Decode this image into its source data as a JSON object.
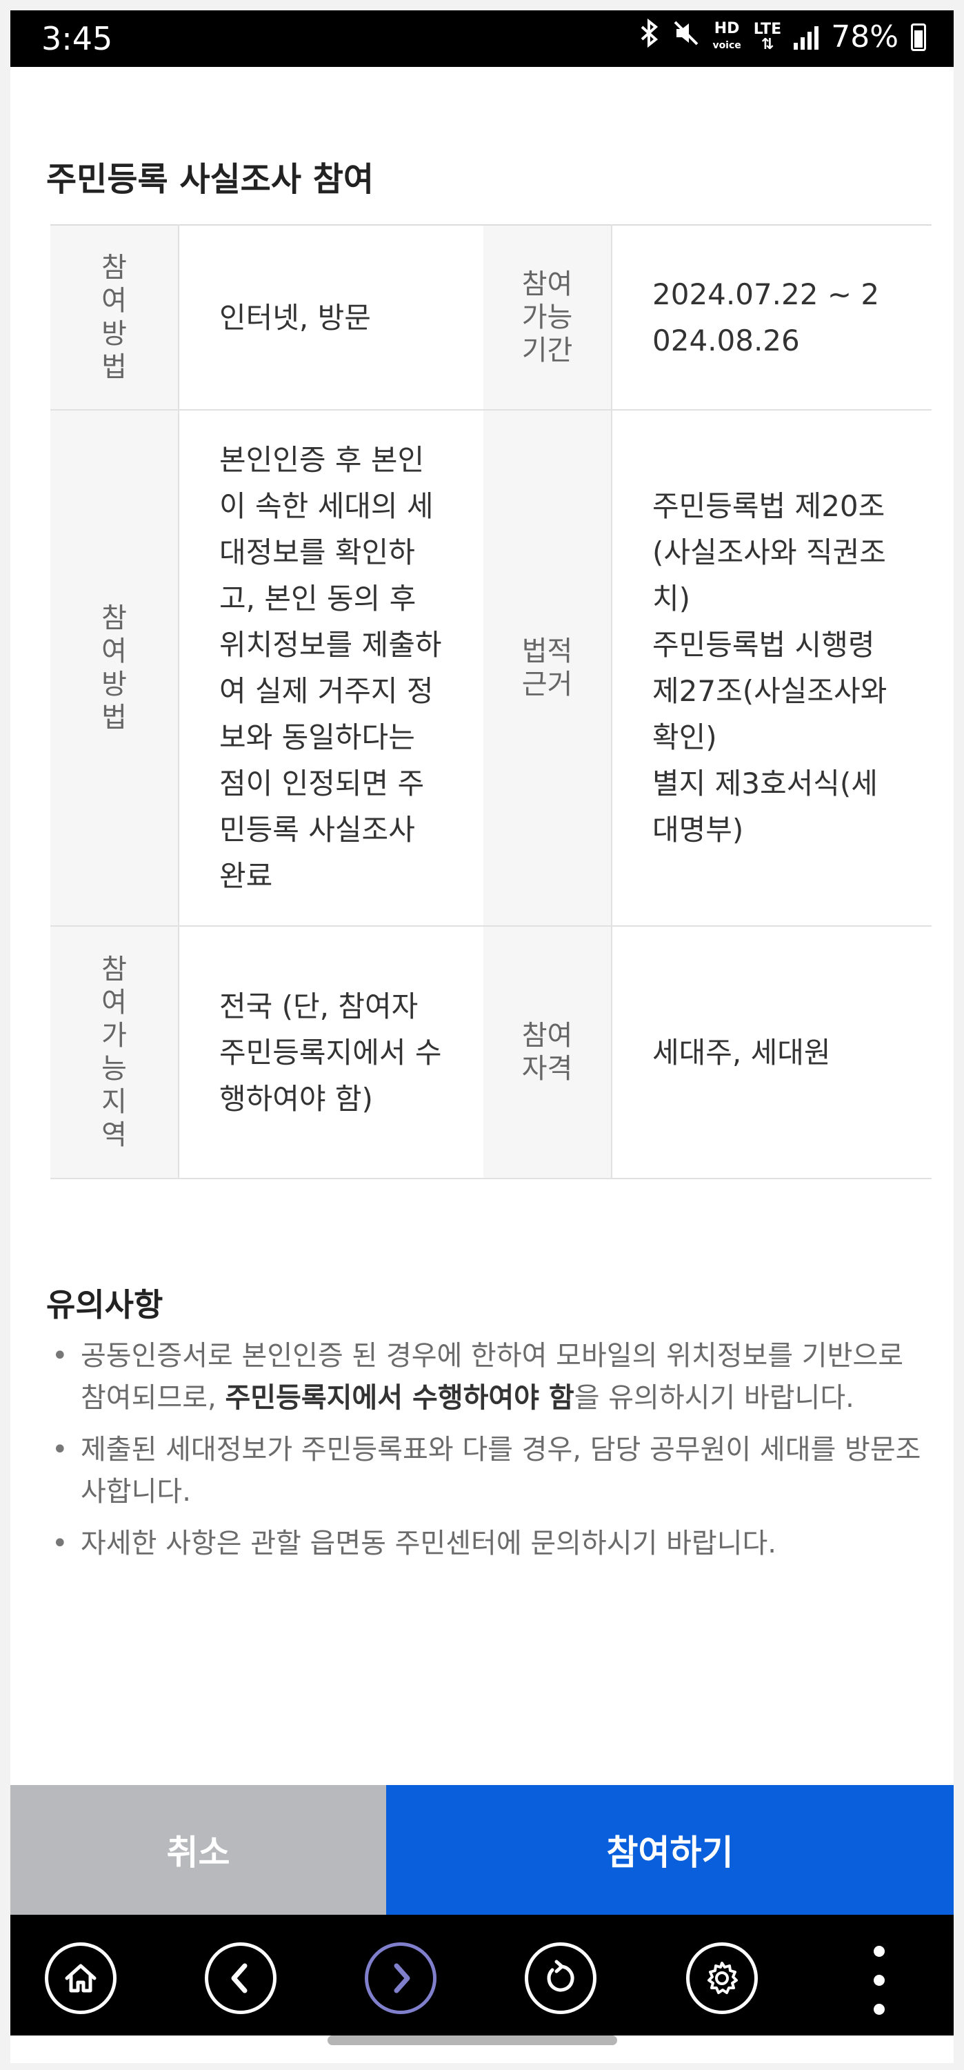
{
  "status_bar": {
    "time": "3:45",
    "network": "LTE",
    "hd_label": "HD",
    "voice_label": "voice",
    "battery": "78%"
  },
  "section_title": "주민등록 사실조사 참여",
  "table": {
    "r1_label_a": "참여방법",
    "r1_value_a": "인터넷, 방문",
    "r1_label_b": "참여가능기간",
    "r1_value_b": "2024.07.22 ~ 2024.08.26",
    "r2_label_a": "참여방법",
    "r2_value_a": "본인인증 후 본인이 속한 세대의 세대정보를 확인하고, 본인 동의 후 위치정보를 제출하여 실제 거주지 정보와 동일하다는 점이 인정되면 주민등록 사실조사 완료",
    "r2_label_b": "법적근거",
    "r2_value_b_1": "주민등록법 제20조(사실조사와 직권조치)",
    "r2_value_b_2": "주민등록법 시행령 제27조(사실조사와 확인)",
    "r2_value_b_3": "별지 제3호서식(세대명부)",
    "r3_label_a": "참여가능지역",
    "r3_value_a": "전국 (단, 참여자 주민등록지에서 수행하여야 함)",
    "r3_label_b": "참여자격",
    "r3_value_b": "세대주, 세대원"
  },
  "notice": {
    "title": "유의사항",
    "item1_pre": "공동인증서로 본인인증 된 경우에 한하여 모바일의 위치정보를 기반으로 참여되므로, ",
    "item1_bold": "주민등록지에서 수행하여야 함",
    "item1_post": "을 유의하시기 바랍니다.",
    "item2": "제출된 세대정보가 주민등록표와 다를 경우, 담당 공무원이 세대를 방문조사합니다.",
    "item3": "자세한 사항은 관할 읍면동 주민센터에 문의하시기 바랍니다."
  },
  "buttons": {
    "cancel": "취소",
    "join": "참여하기"
  },
  "nav": {
    "home_icon": "home-icon",
    "back_icon": "chevron-left-icon",
    "forward_icon": "chevron-right-icon",
    "refresh_icon": "refresh-icon",
    "settings_icon": "gear-icon",
    "more_icon": "more-vertical-icon"
  },
  "colors": {
    "primary": "#0a5fdc",
    "cancel": "#b7b9bd",
    "forward_accent": "#7f7fcc"
  }
}
